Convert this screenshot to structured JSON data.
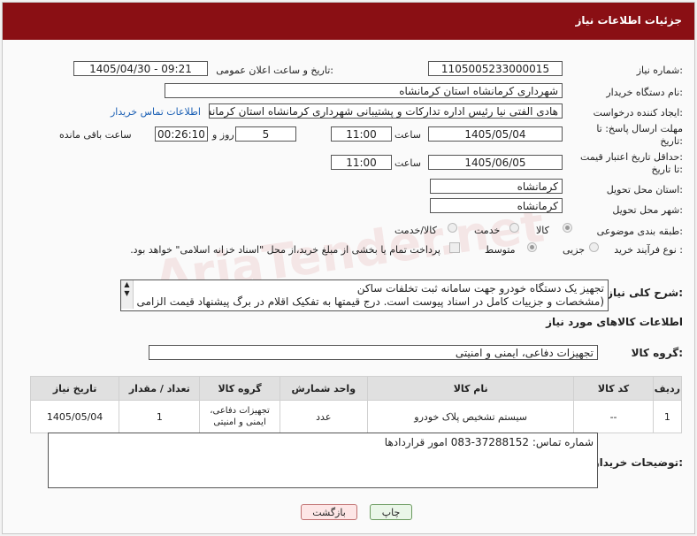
{
  "header": {
    "title": "جزئیات اطلاعات نیاز"
  },
  "watermark": "AriaTender.net",
  "form": {
    "need_number_label": "شماره نیاز:",
    "need_number": "1105005233000015",
    "announce_label": "تاریخ و ساعت اعلان عمومی:",
    "announce_value": "1405/04/30 - 09:21",
    "buyer_org_label": "نام دستگاه خریدار:",
    "buyer_org": "شهرداری کرمانشاه استان کرمانشاه",
    "creator_label": "ایجاد کننده درخواست:",
    "creator": "هادی الفتی نیا رئیس اداره تدارکات و پشتیبانی شهرداری کرمانشاه استان کرمانشاه",
    "contact_link": "اطلاعات تماس خریدار",
    "deadline_label_1": "مهلت ارسال پاسخ: تا",
    "deadline_label_2": "تاریخ:",
    "deadline_date": "1405/05/04",
    "time_word": "ساعت",
    "deadline_time": "11:00",
    "days_value": "5",
    "days_word": "روز و",
    "remaining_time": "00:26:10",
    "remaining_word": "ساعت باقی مانده",
    "validity_label_1": "حداقل تاریخ اعتبار قیمت:",
    "validity_label_2": "تا تاریخ:",
    "validity_date": "1405/06/05",
    "validity_time": "11:00",
    "province_label": "استان محل تحویل:",
    "province": "کرمانشاه",
    "city_label": "شهر محل تحویل:",
    "city": "کرمانشاه",
    "category_label": "طبقه بندی موضوعی:",
    "category_options": [
      "کالا",
      "خدمت",
      "کالا/خدمت"
    ],
    "process_label": "نوع فرآیند خرید :",
    "process_options": [
      "جزیی",
      "متوسط"
    ],
    "payment_note": "پرداخت تمام یا بخشی از مبلغ خرید،از محل \"اسناد خزانه اسلامی\" خواهد بود.",
    "description_label": "شرح کلی نیاز:",
    "description_line1": "تجهیز یک دستگاه خودرو جهت سامانه ثبت تخلفات ساکن",
    "description_line2": "(مشخصات و جزییات کامل در اسناد پیوست است. درج قیمتها به تفکیک اقلام در برگ پیشنهاد قیمت الزامی"
  },
  "goods": {
    "section_title": "اطلاعات کالاهای مورد نیاز",
    "group_label": "گروه کالا:",
    "group_value": "تجهیزات دفاعی، ایمنی و امنیتی",
    "columns": [
      "ردیف",
      "کد کالا",
      "نام کالا",
      "واحد شمارش",
      "گروه کالا",
      "تعداد / مقدار",
      "تاریخ نیاز"
    ],
    "rows": [
      {
        "row": "1",
        "code": "--",
        "name": "سیستم تشخیص پلاک خودرو",
        "unit": "عدد",
        "group": "تجهیزات دفاعی، ایمنی و امنیتی",
        "qty": "1",
        "date": "1405/05/04"
      }
    ]
  },
  "buyer_notes": {
    "label": "توضیحات خریدار:",
    "text": "شماره تماس: 37288152-083 امور قراردادها"
  },
  "buttons": {
    "print": "چاپ",
    "back": "بازگشت"
  }
}
